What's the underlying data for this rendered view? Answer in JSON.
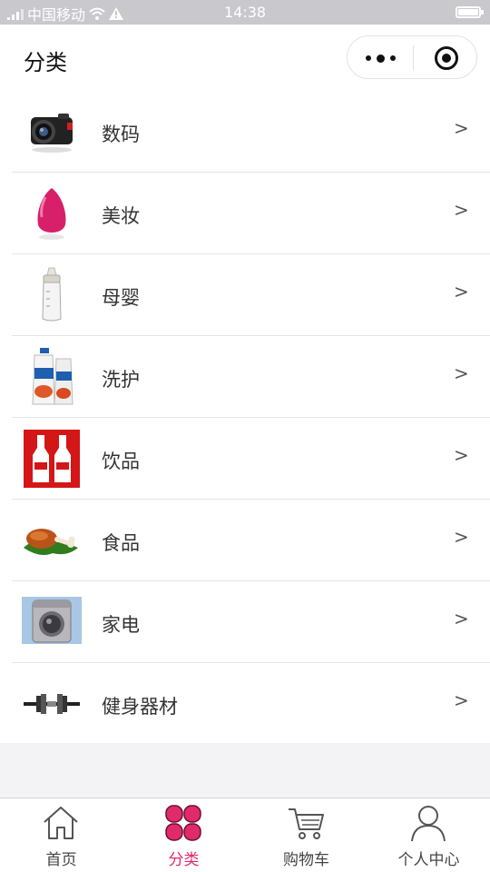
{
  "status_bar": {
    "carrier": "中国移动",
    "time": "14:38"
  },
  "nav": {
    "title": "分类"
  },
  "categories": [
    {
      "label": "数码",
      "arrow": ">",
      "icon": "camera-icon"
    },
    {
      "label": "美妆",
      "arrow": ">",
      "icon": "makeup-sponge-icon"
    },
    {
      "label": "母婴",
      "arrow": ">",
      "icon": "baby-bottle-icon"
    },
    {
      "label": "洗护",
      "arrow": ">",
      "icon": "shampoo-bottle-icon"
    },
    {
      "label": "饮品",
      "arrow": ">",
      "icon": "beverage-bottles-icon"
    },
    {
      "label": "食品",
      "arrow": ">",
      "icon": "drumstick-icon"
    },
    {
      "label": "家电",
      "arrow": ">",
      "icon": "washing-machine-icon"
    },
    {
      "label": "健身器材",
      "arrow": ">",
      "icon": "dumbbell-icon"
    }
  ],
  "tabbar": {
    "items": [
      {
        "label": "首页",
        "icon": "home-icon",
        "active": false
      },
      {
        "label": "分类",
        "icon": "category-clover-icon",
        "active": true
      },
      {
        "label": "购物车",
        "icon": "cart-icon",
        "active": false
      },
      {
        "label": "个人中心",
        "icon": "person-icon",
        "active": false
      }
    ]
  },
  "colors": {
    "accent": "#e02a6c",
    "status_bar": "#c9c8cd",
    "page_bg": "#f3f3f5"
  }
}
